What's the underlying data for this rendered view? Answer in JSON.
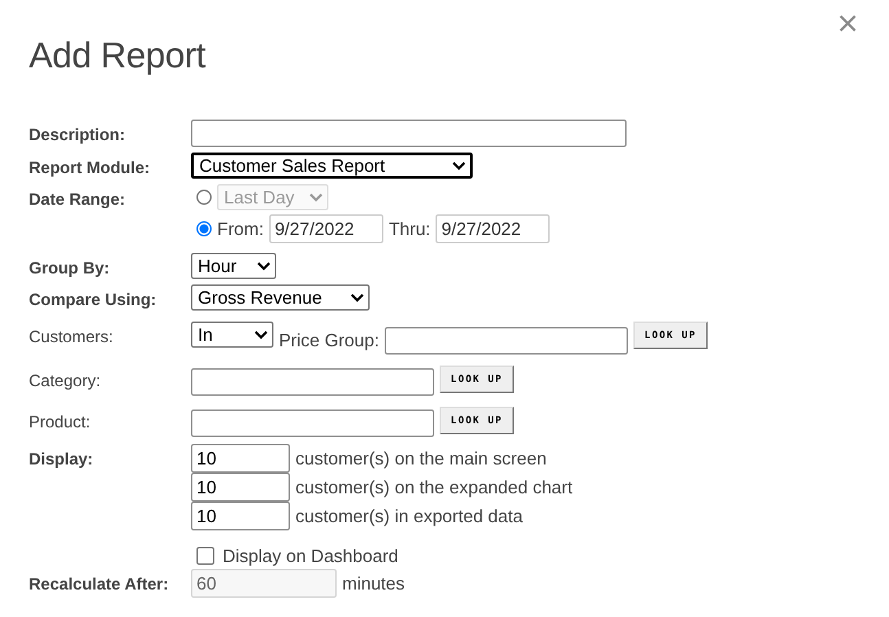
{
  "dialog": {
    "title": "Add Report"
  },
  "fields": [
    {
      "kind": "text",
      "label": "Description:",
      "emphasized": true
    },
    {
      "kind": "select",
      "label": "Report Module:",
      "emphasized": true,
      "value": "Customer Sales Report",
      "focused": true
    },
    {
      "kind": "daterange",
      "label": "Date Range:",
      "emphasized": true,
      "options": [
        {
          "kind": "preset",
          "selected": false,
          "value": "Last Day",
          "disabled": true
        },
        {
          "kind": "range",
          "selected": true,
          "from_label": "From:",
          "from": "9/27/2022",
          "thru_label": "Thru:",
          "thru": "9/27/2022"
        }
      ]
    },
    {
      "kind": "select",
      "label": "Group By:",
      "emphasized": true,
      "value": "Hour",
      "focused": false
    },
    {
      "kind": "select",
      "label": "Compare Using:",
      "emphasized": true,
      "value": "Gross Revenue",
      "focused": false
    },
    {
      "kind": "customers",
      "label": "Customers:",
      "emphasized": false,
      "value": "In",
      "field_label": "Price Group:",
      "button": "LOOK UP"
    },
    {
      "kind": "lookup",
      "label": "Category:",
      "emphasized": false,
      "button": "LOOK UP"
    },
    {
      "kind": "lookup",
      "label": "Product:",
      "emphasized": false,
      "button": "LOOK UP"
    },
    {
      "kind": "display",
      "label": "Display:",
      "emphasized": true,
      "entries": [
        {
          "value": "10",
          "text": "customer(s) on the main screen"
        },
        {
          "value": "10",
          "text": "customer(s) on the expanded chart"
        },
        {
          "value": "10",
          "text": "customer(s) in exported data"
        }
      ]
    },
    {
      "kind": "checkbox",
      "text": "Display on Dashboard",
      "checked": false
    },
    {
      "kind": "number",
      "label": "Recalculate After:",
      "emphasized": true,
      "value": "60",
      "disabled": true,
      "suffix": "minutes"
    }
  ]
}
